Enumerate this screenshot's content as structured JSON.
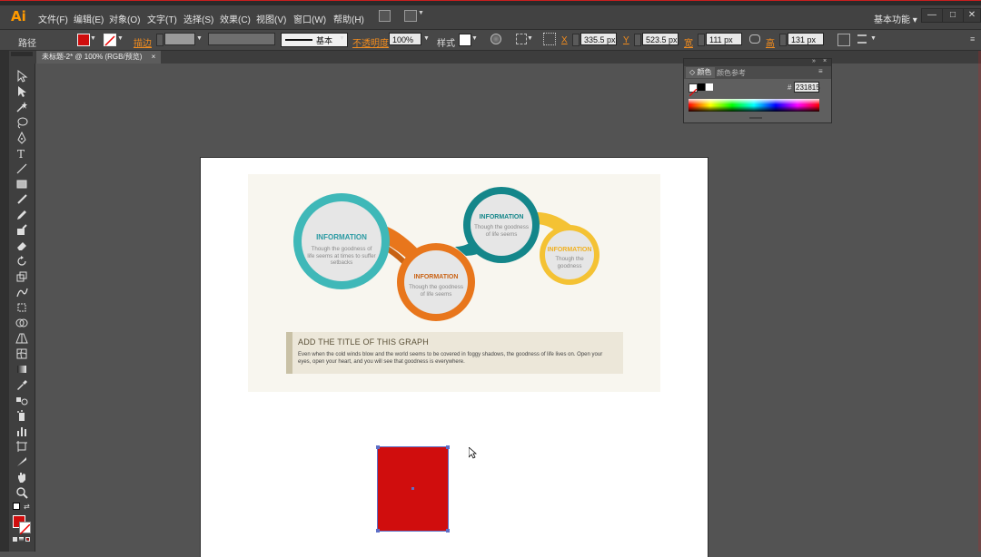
{
  "app": {
    "logo": "Ai",
    "workspace": "基本功能"
  },
  "menu": [
    "文件(F)",
    "编辑(E)",
    "对象(O)",
    "文字(T)",
    "选择(S)",
    "效果(C)",
    "视图(V)",
    "窗口(W)",
    "帮助(H)"
  ],
  "window_buttons": [
    "—",
    "□",
    "✕"
  ],
  "control_bar": {
    "selection_label": "路径",
    "stroke_label": "描边",
    "brush_label": "基本",
    "opacity_label": "不透明度",
    "opacity_value": "100%",
    "style_label": "样式",
    "x_label": "X",
    "x_value": "335.5 px",
    "y_label": "Y",
    "y_value": "523.5 px",
    "w_label": "宽",
    "w_value": "111 px",
    "h_label": "高",
    "h_value": "131 px",
    "colors": {
      "fill": "#d00d0d",
      "accent_orange": "#f28c1e"
    }
  },
  "document_tab": {
    "label": "未标题-2* @ 100% (RGB/预览)",
    "close": "×"
  },
  "color_panel": {
    "tabs": [
      "颜色",
      "颜色参考"
    ],
    "hex_label": "#",
    "hex_value": "231815"
  },
  "infographic": {
    "bubbles": [
      {
        "title": "INFORMATION",
        "text": "Though the goodness of life seems at times to suffer setbacks",
        "color": "#3fb8b8"
      },
      {
        "title": "INFORMATION",
        "text": "Though the goodness of life seems",
        "color": "#e8761c"
      },
      {
        "title": "INFORMATION",
        "text": "Though the goodness of life seems",
        "color": "#14868a"
      },
      {
        "title": "INFORMATION",
        "text": "Though the goodness",
        "color": "#f4c234"
      }
    ],
    "heading": "ADD THE TITLE OF THIS GRAPH",
    "body": "Even when the cold winds blow and the world seems to be covered in foggy shadows, the goodness of life lives on. Open your eyes, open your heart, and you will see that goodness is everywhere."
  },
  "selected_shape": {
    "type": "rectangle",
    "fill": "#d00d0d"
  }
}
